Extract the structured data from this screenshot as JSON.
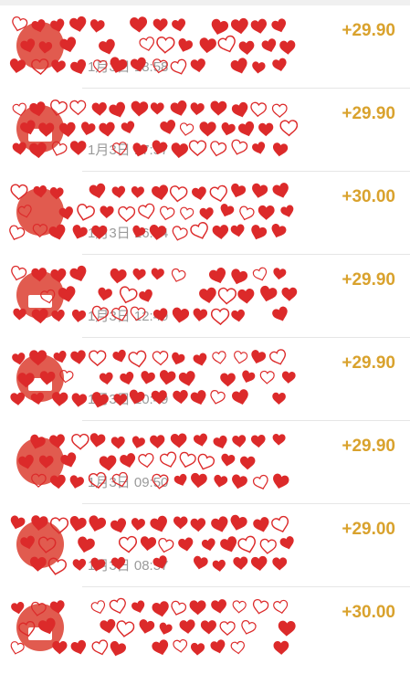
{
  "transactions": [
    {
      "time": "1月3日 18:58",
      "amount": "+29.90",
      "name": ""
    },
    {
      "time": "1月3日 17:57",
      "amount": "+29.90",
      "name": ""
    },
    {
      "time": "1月3日 16:54",
      "amount": "+30.00",
      "name": ""
    },
    {
      "time": "1月3日 12:49",
      "amount": "+29.90",
      "name": ""
    },
    {
      "time": "1月3日 10:49",
      "amount": "+29.90",
      "name": ""
    },
    {
      "time": "1月3日 09:50",
      "amount": "+29.90",
      "name": ""
    },
    {
      "time": "1月3日 08:57",
      "amount": "+29.00",
      "name": ""
    },
    {
      "time": "",
      "amount": "+30.00",
      "name": ""
    }
  ],
  "colors": {
    "amount": "#d9a22d",
    "time": "#9a9a9a",
    "divider": "#e6e6e6",
    "avatar": "#e15b4f",
    "privacy_overlay": "#dc2a2a"
  }
}
